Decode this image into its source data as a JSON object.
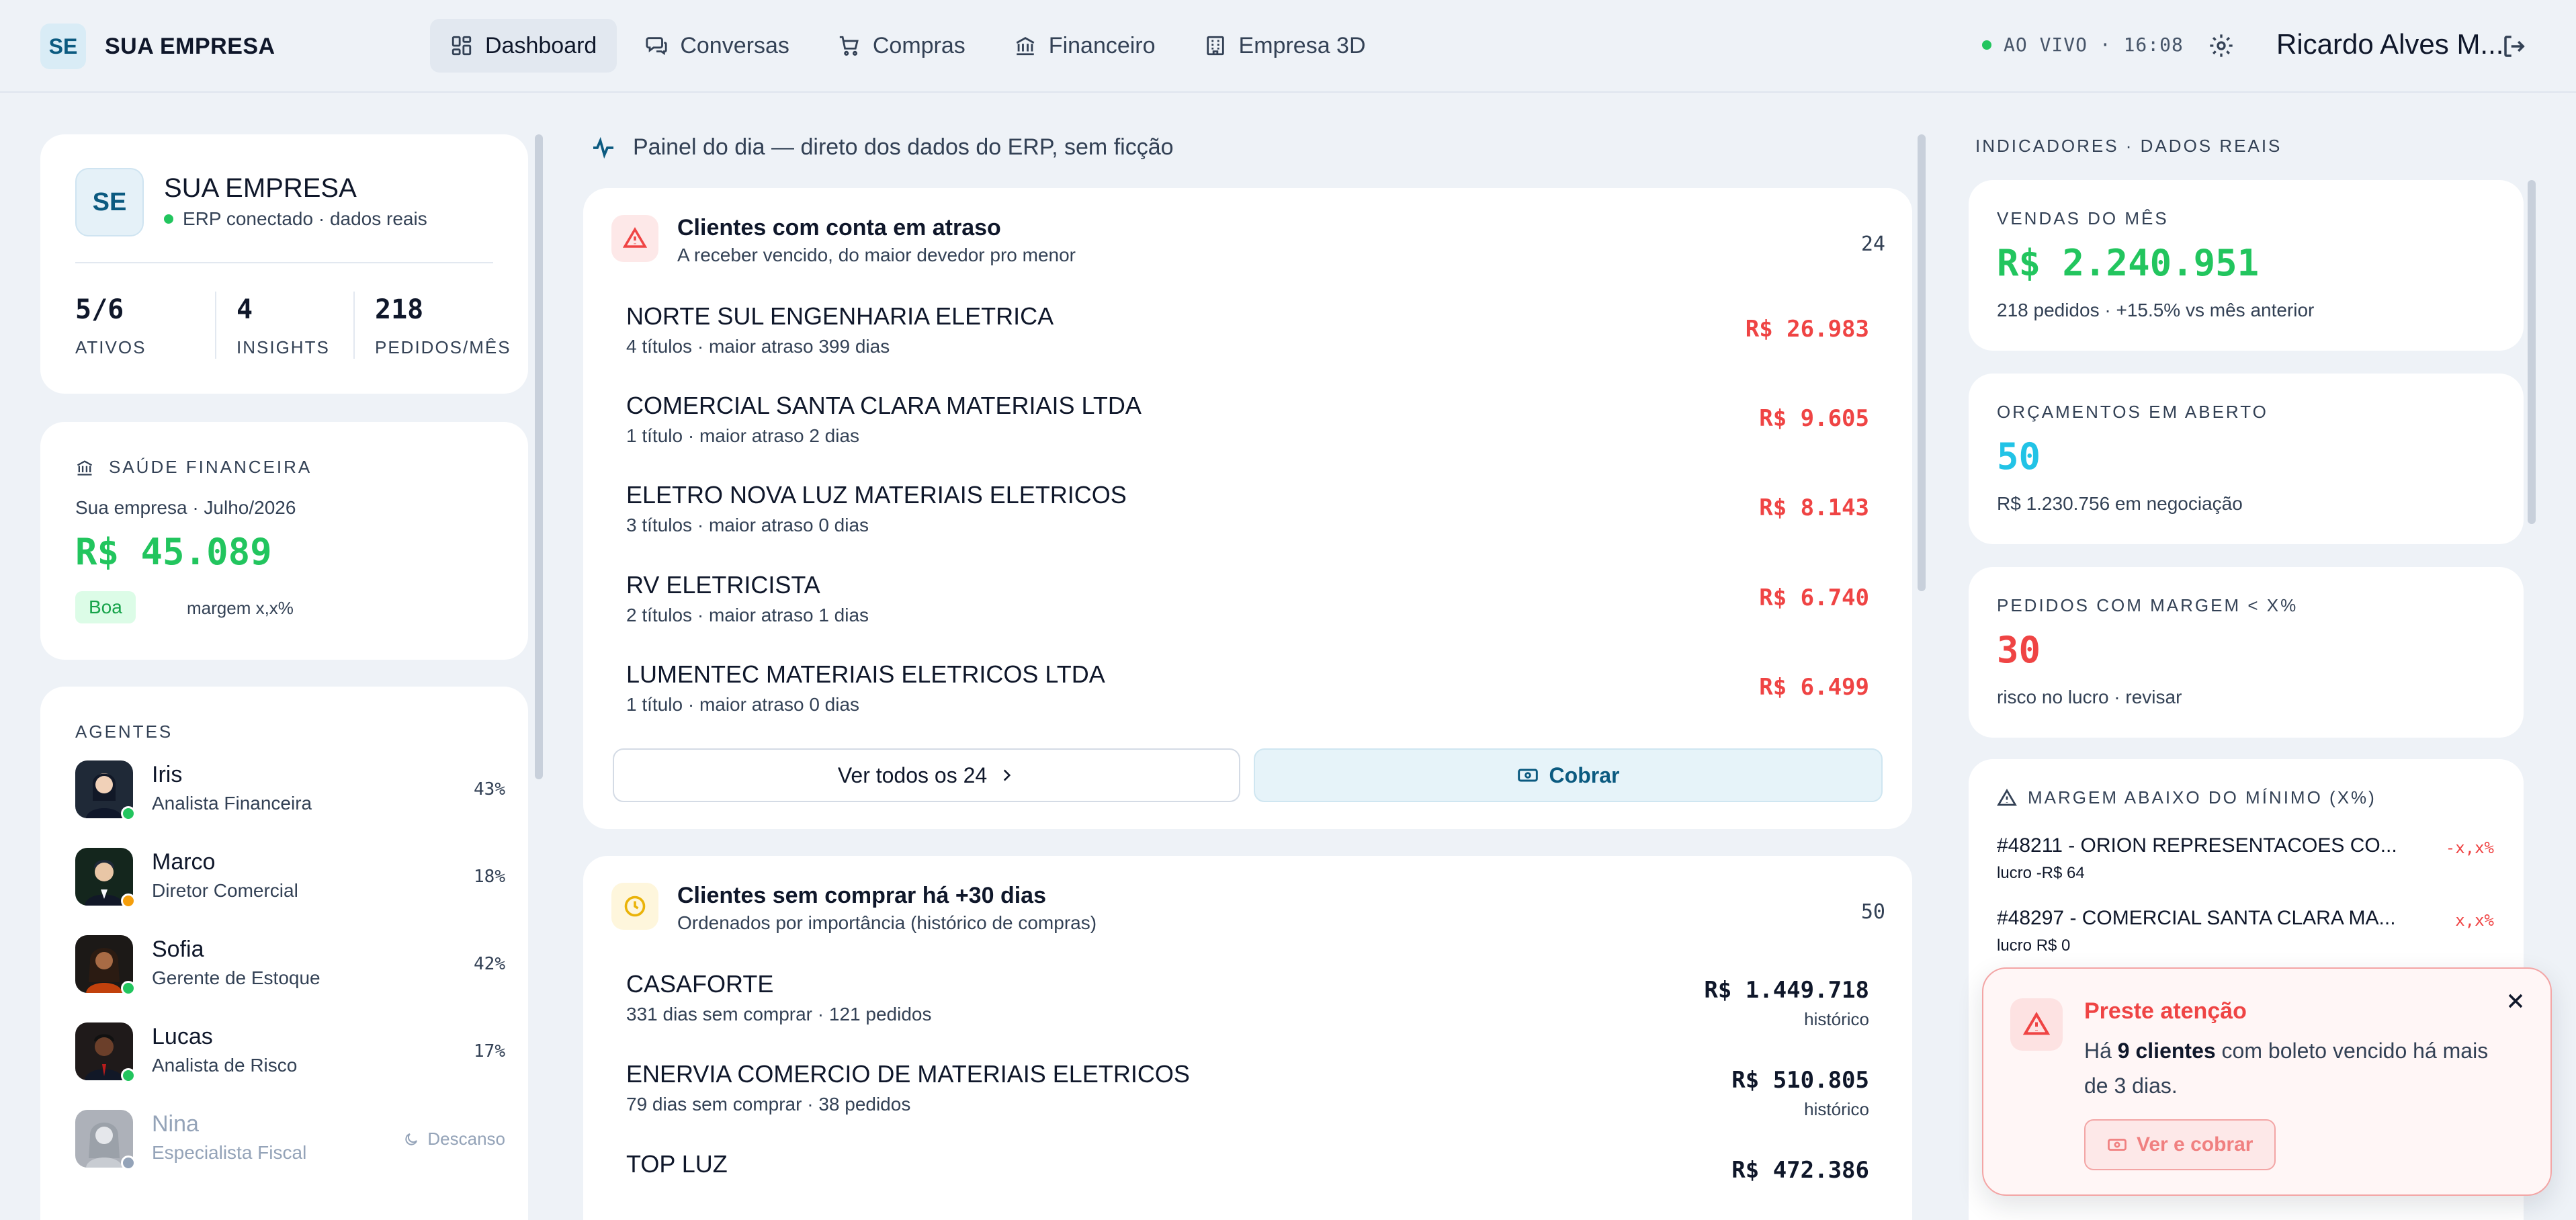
{
  "nav": {
    "brand_logo": "SE",
    "brand_name": "SUA EMPRESA",
    "items": [
      {
        "label": "Dashboard",
        "icon": "dashboard-icon",
        "active": true
      },
      {
        "label": "Conversas",
        "icon": "chat-icon"
      },
      {
        "label": "Compras",
        "icon": "cart-icon"
      },
      {
        "label": "Financeiro",
        "icon": "bank-icon"
      },
      {
        "label": "Empresa 3D",
        "icon": "building-icon"
      }
    ],
    "live_status": "AO VIVO · 16:08",
    "user_name": "Ricardo Alves M..."
  },
  "company": {
    "logo": "SE",
    "name": "SUA EMPRESA",
    "status": "ERP conectado · dados reais",
    "stats": [
      {
        "value": "5/6",
        "label": "ATIVOS"
      },
      {
        "value": "4",
        "label": "INSIGHTS"
      },
      {
        "value": "218",
        "label": "PEDIDOS/MÊS"
      }
    ]
  },
  "health": {
    "title": "SAÚDE FINANCEIRA",
    "subtitle": "Sua empresa · Julho/2026",
    "value": "R$ 45.089",
    "badge": "Boa",
    "margin": "margem x,x%"
  },
  "agents": {
    "title": "AGENTES",
    "items": [
      {
        "name": "Iris",
        "role": "Analista Financeira",
        "pct": "43%",
        "status_color": "#22c55e"
      },
      {
        "name": "Marco",
        "role": "Diretor Comercial",
        "pct": "18%",
        "status_color": "#f59e0b"
      },
      {
        "name": "Sofia",
        "role": "Gerente de Estoque",
        "pct": "42%",
        "status_color": "#22c55e"
      },
      {
        "name": "Lucas",
        "role": "Analista de Risco",
        "pct": "17%",
        "status_color": "#22c55e"
      },
      {
        "name": "Nina",
        "role": "Especialista Fiscal",
        "rest_label": "Descanso",
        "status_color": "#94a3b8"
      }
    ]
  },
  "panel": {
    "header": "Painel do dia — direto dos dados do ERP, sem ficção"
  },
  "overdue": {
    "title": "Clientes com conta em atraso",
    "subtitle": "A receber vencido, do maior devedor pro menor",
    "count": "24",
    "rows": [
      {
        "name": "NORTE SUL ENGENHARIA ELETRICA",
        "sub": "4 títulos · maior atraso 399 dias",
        "amount": "R$ 26.983"
      },
      {
        "name": "COMERCIAL SANTA CLARA MATERIAIS LTDA",
        "sub": "1 título · maior atraso 2 dias",
        "amount": "R$ 9.605"
      },
      {
        "name": "ELETRO NOVA LUZ MATERIAIS ELETRICOS",
        "sub": "3 títulos · maior atraso 0 dias",
        "amount": "R$ 8.143"
      },
      {
        "name": "RV ELETRICISTA",
        "sub": "2 títulos · maior atraso 1 dias",
        "amount": "R$ 6.740"
      },
      {
        "name": "LUMENTEC MATERIAIS ELETRICOS LTDA",
        "sub": "1 título · maior atraso 0 dias",
        "amount": "R$ 6.499"
      }
    ],
    "see_all_label": "Ver todos os 24",
    "cobrar_label": "Cobrar"
  },
  "inactive": {
    "title": "Clientes sem comprar há +30 dias",
    "subtitle": "Ordenados por importância (histórico de compras)",
    "count": "50",
    "rows": [
      {
        "name": "CASAFORTE",
        "sub": "331 dias sem comprar · 121 pedidos",
        "amount": "R$ 1.449.718",
        "hist": "histórico"
      },
      {
        "name": "ENERVIA COMERCIO DE MATERIAIS ELETRICOS",
        "sub": "79 dias sem comprar · 38 pedidos",
        "amount": "R$ 510.805",
        "hist": "histórico"
      },
      {
        "name": "TOP LUZ",
        "sub": "",
        "amount": "R$ 472.386",
        "hist": ""
      }
    ]
  },
  "indicators": {
    "title": "INDICADORES · DADOS REAIS",
    "kpis": [
      {
        "label": "VENDAS DO MÊS",
        "value": "R$ 2.240.951",
        "sub": "218 pedidos · +15.5% vs mês anterior",
        "color": "#22c55e"
      },
      {
        "label": "ORÇAMENTOS EM ABERTO",
        "value": "50",
        "sub": "R$ 1.230.756 em negociação",
        "color": "#22c3e6"
      },
      {
        "label": "PEDIDOS COM MARGEM < x%",
        "value": "30",
        "sub": "risco no lucro · revisar",
        "color": "#ef4444"
      }
    ],
    "margin": {
      "title": "MARGEM ABAIXO DO MÍNIMO (x%)",
      "rows": [
        {
          "name": "#48211 - ORION REPRESENTACOES CO...",
          "sub": "lucro -R$ 64",
          "pct": "-x,x%"
        },
        {
          "name": "#48297 - COMERCIAL SANTA CLARA MA...",
          "sub": "lucro R$ 0",
          "pct": "x,x%"
        }
      ]
    }
  },
  "toast": {
    "title": "Preste atenção",
    "body_prefix": "Há ",
    "body_bold": "9 clientes",
    "body_suffix": " com boleto vencido há mais de 3 dias.",
    "button": "Ver e cobrar"
  }
}
